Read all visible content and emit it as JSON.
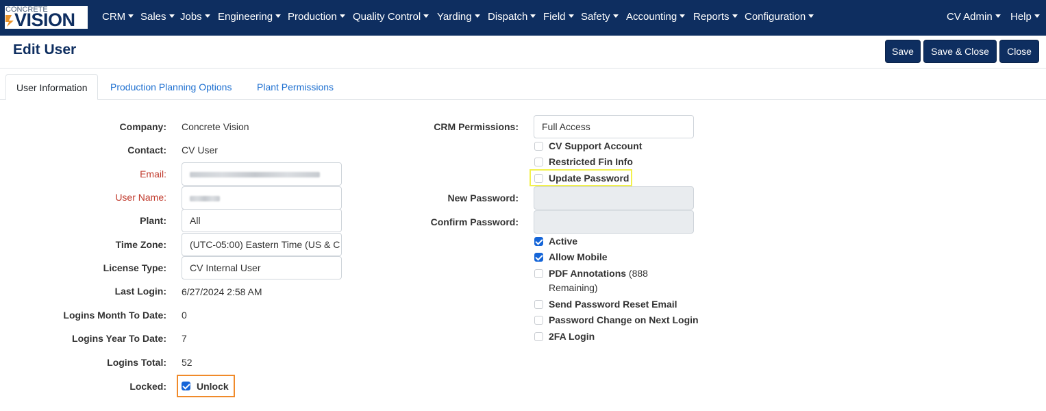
{
  "logo": {
    "small": "CONCRETE",
    "big": "VISION"
  },
  "nav": {
    "items": [
      "CRM",
      "Sales",
      "Jobs",
      "Engineering",
      "Production",
      "Quality Control",
      "Yarding",
      "Dispatch",
      "Field",
      "Safety",
      "Accounting",
      "Reports",
      "Configuration"
    ],
    "user": "CV Admin",
    "help": "Help"
  },
  "header": {
    "title": "Edit User",
    "save": "Save",
    "save_close": "Save & Close",
    "close": "Close"
  },
  "tabs": [
    "User Information",
    "Production Planning Options",
    "Plant Permissions"
  ],
  "form": {
    "company_label": "Company:",
    "company": "Concrete Vision",
    "contact_label": "Contact:",
    "contact": "CV User",
    "email_label": "Email:",
    "username_label": "User Name:",
    "plant_label": "Plant:",
    "plant": "All",
    "timezone_label": "Time Zone:",
    "timezone": "(UTC-05:00) Eastern Time (US & C",
    "license_label": "License Type:",
    "license": "CV Internal User",
    "last_login_label": "Last Login:",
    "last_login": "6/27/2024 2:58 AM",
    "logins_mtd_label": "Logins Month To Date:",
    "logins_mtd": "0",
    "logins_ytd_label": "Logins Year To Date:",
    "logins_ytd": "7",
    "logins_total_label": "Logins Total:",
    "logins_total": "52",
    "locked_label": "Locked:",
    "unlock": "Unlock",
    "crm_label": "CRM Permissions:",
    "crm": "Full Access",
    "cv_support": "CV Support Account",
    "restricted_fin": "Restricted Fin Info",
    "update_password": "Update Password",
    "new_password_label": "New Password:",
    "confirm_password_label": "Confirm Password:",
    "active": "Active",
    "allow_mobile": "Allow Mobile",
    "pdf_annotations": "PDF Annotations",
    "pdf_remaining_1": "(888",
    "pdf_remaining_2": "Remaining)",
    "send_reset": "Send Password Reset Email",
    "pw_change": "Password Change on Next Login",
    "twofa": "2FA Login"
  },
  "colors": {
    "nav_bg": "#0e2e60",
    "accent": "#1565d8",
    "required_label": "#c0392b",
    "highlight_yellow": "#f2f14e",
    "highlight_orange": "#f08a2a"
  }
}
